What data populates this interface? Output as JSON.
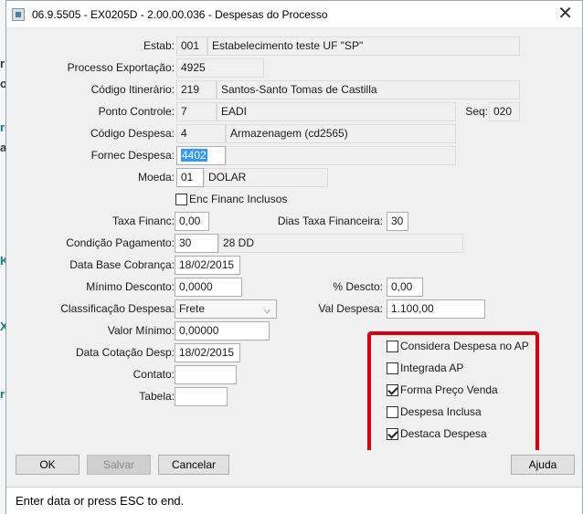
{
  "window": {
    "title": "06.9.5505 - EX0205D - 2.00.00.036 - Despesas do Processo"
  },
  "background": {
    "left_chars": [
      "r",
      "o",
      "ri",
      "a",
      "Kı",
      "X",
      "r"
    ]
  },
  "form": {
    "estab": {
      "label": "Estab:",
      "code": "001",
      "desc": "Estabelecimento teste UF \"SP\""
    },
    "processo": {
      "label": "Processo Exportação:",
      "value": "4925"
    },
    "itinerario": {
      "label": "Código Itinerário:",
      "code": "219",
      "desc": "Santos-Santo Tomas de Castilla"
    },
    "ponto": {
      "label": "Ponto Controle:",
      "code": "7",
      "desc": "EADI",
      "seq_label": "Seq:",
      "seq_value": "020"
    },
    "despesa": {
      "label": "Código Despesa:",
      "code": "4",
      "desc": "Armazenagem (cd2565)"
    },
    "fornec": {
      "label": "Fornec Despesa:",
      "value": "4402",
      "desc": ""
    },
    "moeda": {
      "label": "Moeda:",
      "code": "01",
      "desc": "DOLAR"
    },
    "enc_financ": {
      "label": "Enc Financ Inclusos",
      "checked": false
    },
    "taxa_financ": {
      "label": "Taxa Financ:",
      "value": "0,00"
    },
    "dias_taxa": {
      "label": "Dias Taxa Financeira:",
      "value": "30"
    },
    "condicao": {
      "label": "Condição Pagamento:",
      "code": "30",
      "desc": "28 DD"
    },
    "data_base": {
      "label": "Data Base Cobrança:",
      "value": "18/02/2015"
    },
    "minimo_desconto": {
      "label": "Mínimo Desconto:",
      "value": "0,0000"
    },
    "pct_descto": {
      "label": "% Descto:",
      "value": "0,00"
    },
    "classificacao": {
      "label": "Classificação Despesa:",
      "value": "Frete"
    },
    "val_despesa": {
      "label": "Val Despesa:",
      "value": "1.100,00"
    },
    "valor_minimo": {
      "label": "Valor Mínimo:",
      "value": "0,00000"
    },
    "data_cotacao": {
      "label": "Data Cotação Desp:",
      "value": "18/02/2015"
    },
    "contato": {
      "label": "Contato:",
      "value": ""
    },
    "tabela": {
      "label": "Tabela:",
      "value": ""
    }
  },
  "options": {
    "considera": {
      "label": "Considera Despesa no AP",
      "checked": false
    },
    "integrada": {
      "label": "Integrada AP",
      "checked": false
    },
    "forma_preco": {
      "label": "Forma Preço Venda",
      "checked": true
    },
    "despesa_inclusa": {
      "label": "Despesa Inclusa",
      "checked": false
    },
    "destaca": {
      "label": "Destaca Despesa",
      "checked": true
    },
    "highlight_color": "#d8000f"
  },
  "buttons": {
    "ok": "OK",
    "salvar": "Salvar",
    "cancelar": "Cancelar",
    "ajuda": "Ajuda"
  },
  "status": {
    "text": "Enter data or press ESC to end."
  }
}
